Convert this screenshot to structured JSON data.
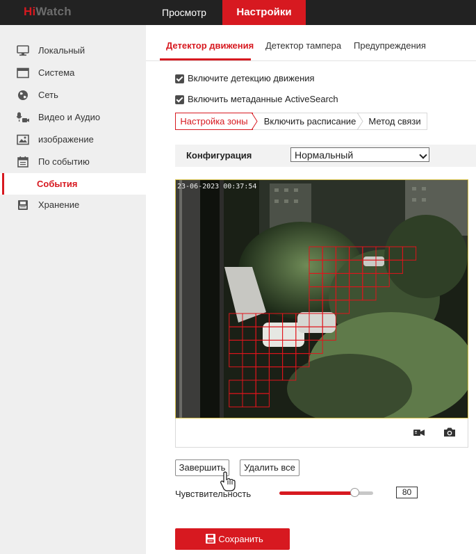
{
  "brand": {
    "name_part1": "Hi",
    "name_part2": "Watch"
  },
  "top_nav": {
    "view": "Просмотр",
    "settings": "Настройки"
  },
  "sidebar": {
    "items": [
      {
        "label": "Локальный",
        "icon": "monitor-icon"
      },
      {
        "label": "Система",
        "icon": "system-window-icon"
      },
      {
        "label": "Сеть",
        "icon": "globe-icon"
      },
      {
        "label": "Видео и Аудио",
        "icon": "mic-camera-icon"
      },
      {
        "label": "изображение",
        "icon": "image-icon"
      },
      {
        "label": "По событию",
        "icon": "calendar-icon"
      },
      {
        "label": "Хранение",
        "icon": "storage-icon"
      }
    ],
    "active_sub": "События"
  },
  "tabs": {
    "motion": "Детектор движения",
    "tamper": "Детектор тампера",
    "warnings": "Предупреждения"
  },
  "options": {
    "enable_motion": "Включите детекцию движения",
    "enable_metadata": "Включить метаданные ActiveSearch",
    "enable_motion_checked": true,
    "enable_metadata_checked": true
  },
  "steps": {
    "zone": "Настройка зоны",
    "schedule": "Включить расписание",
    "linkage": "Метод связи"
  },
  "config": {
    "label": "Конфигурация",
    "value": "Нормальный"
  },
  "video": {
    "timestamp": "23-06-2023 00:37:54"
  },
  "buttons": {
    "finish": "Завершить",
    "delete_all": "Удалить все",
    "save": "Сохранить"
  },
  "sensitivity": {
    "label": "Чувствительность",
    "value": "80",
    "level_percent": 80
  },
  "colors": {
    "accent": "#d71920",
    "topbar": "#222222",
    "sidebar": "#efefef"
  }
}
